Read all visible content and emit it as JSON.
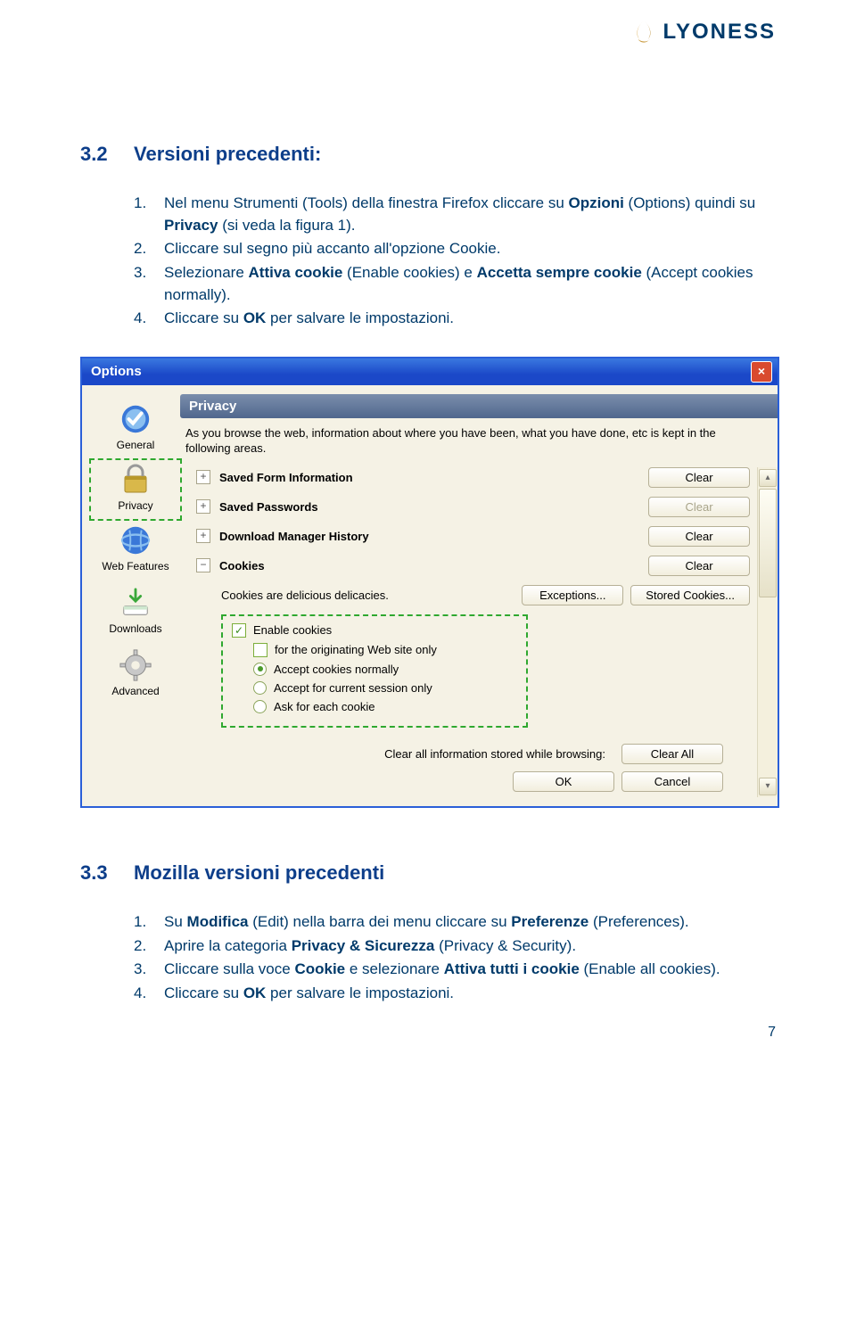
{
  "logo": {
    "text": "LYONESS"
  },
  "section1": {
    "num": "3.2",
    "title": "Versioni precedenti:",
    "items": [
      "Nel menu Strumenti (Tools) della finestra Firefox cliccare su <b>Opzioni</b> (Options) quindi su <b>Privacy</b> (si veda la figura 1).",
      "Cliccare sul segno più accanto all'opzione Cookie.",
      "Selezionare <b>Attiva cookie</b> (Enable cookies) e <b>Accetta sempre cookie</b> (Accept cookies normally).",
      "Cliccare su <b>OK</b> per salvare le impostazioni."
    ]
  },
  "section2": {
    "num": "3.3",
    "title": "Mozilla versioni precedenti",
    "items": [
      "Su <b>Modifica</b> (Edit) nella barra dei menu cliccare su <b>Preferenze</b> (Preferences).",
      "Aprire la categoria <b>Privacy & Sicurezza</b> (Privacy & Security).",
      "Cliccare sulla voce <b>Cookie</b> e selezionare <b>Attiva tutti i cookie</b> (Enable all cookies).",
      "Cliccare su <b>OK</b> per salvare le impostazioni."
    ]
  },
  "page_number": "7",
  "shot": {
    "title": "Options",
    "sidebar": {
      "general": "General",
      "privacy": "Privacy",
      "webfeatures": "Web Features",
      "downloads": "Downloads",
      "advanced": "Advanced"
    },
    "head": "Privacy",
    "desc": "As you browse the web, information about where you have been, what you have done, etc is kept in the following areas.",
    "rows": {
      "sfi": "Saved Form Information",
      "sp": "Saved Passwords",
      "dmh": "Download Manager History",
      "cookies": "Cookies",
      "cookies_sub": "Cookies are delicious delicacies."
    },
    "buttons": {
      "clear": "Clear",
      "exceptions": "Exceptions...",
      "stored": "Stored Cookies...",
      "clearall": "Clear All",
      "ok": "OK",
      "cancel": "Cancel"
    },
    "checks": {
      "enable": "Enable cookies",
      "originating": "for the originating Web site only",
      "normally": "Accept cookies normally",
      "session": "Accept for current session only",
      "ask": "Ask for each cookie"
    },
    "footer_label": "Clear all information stored while browsing:"
  }
}
